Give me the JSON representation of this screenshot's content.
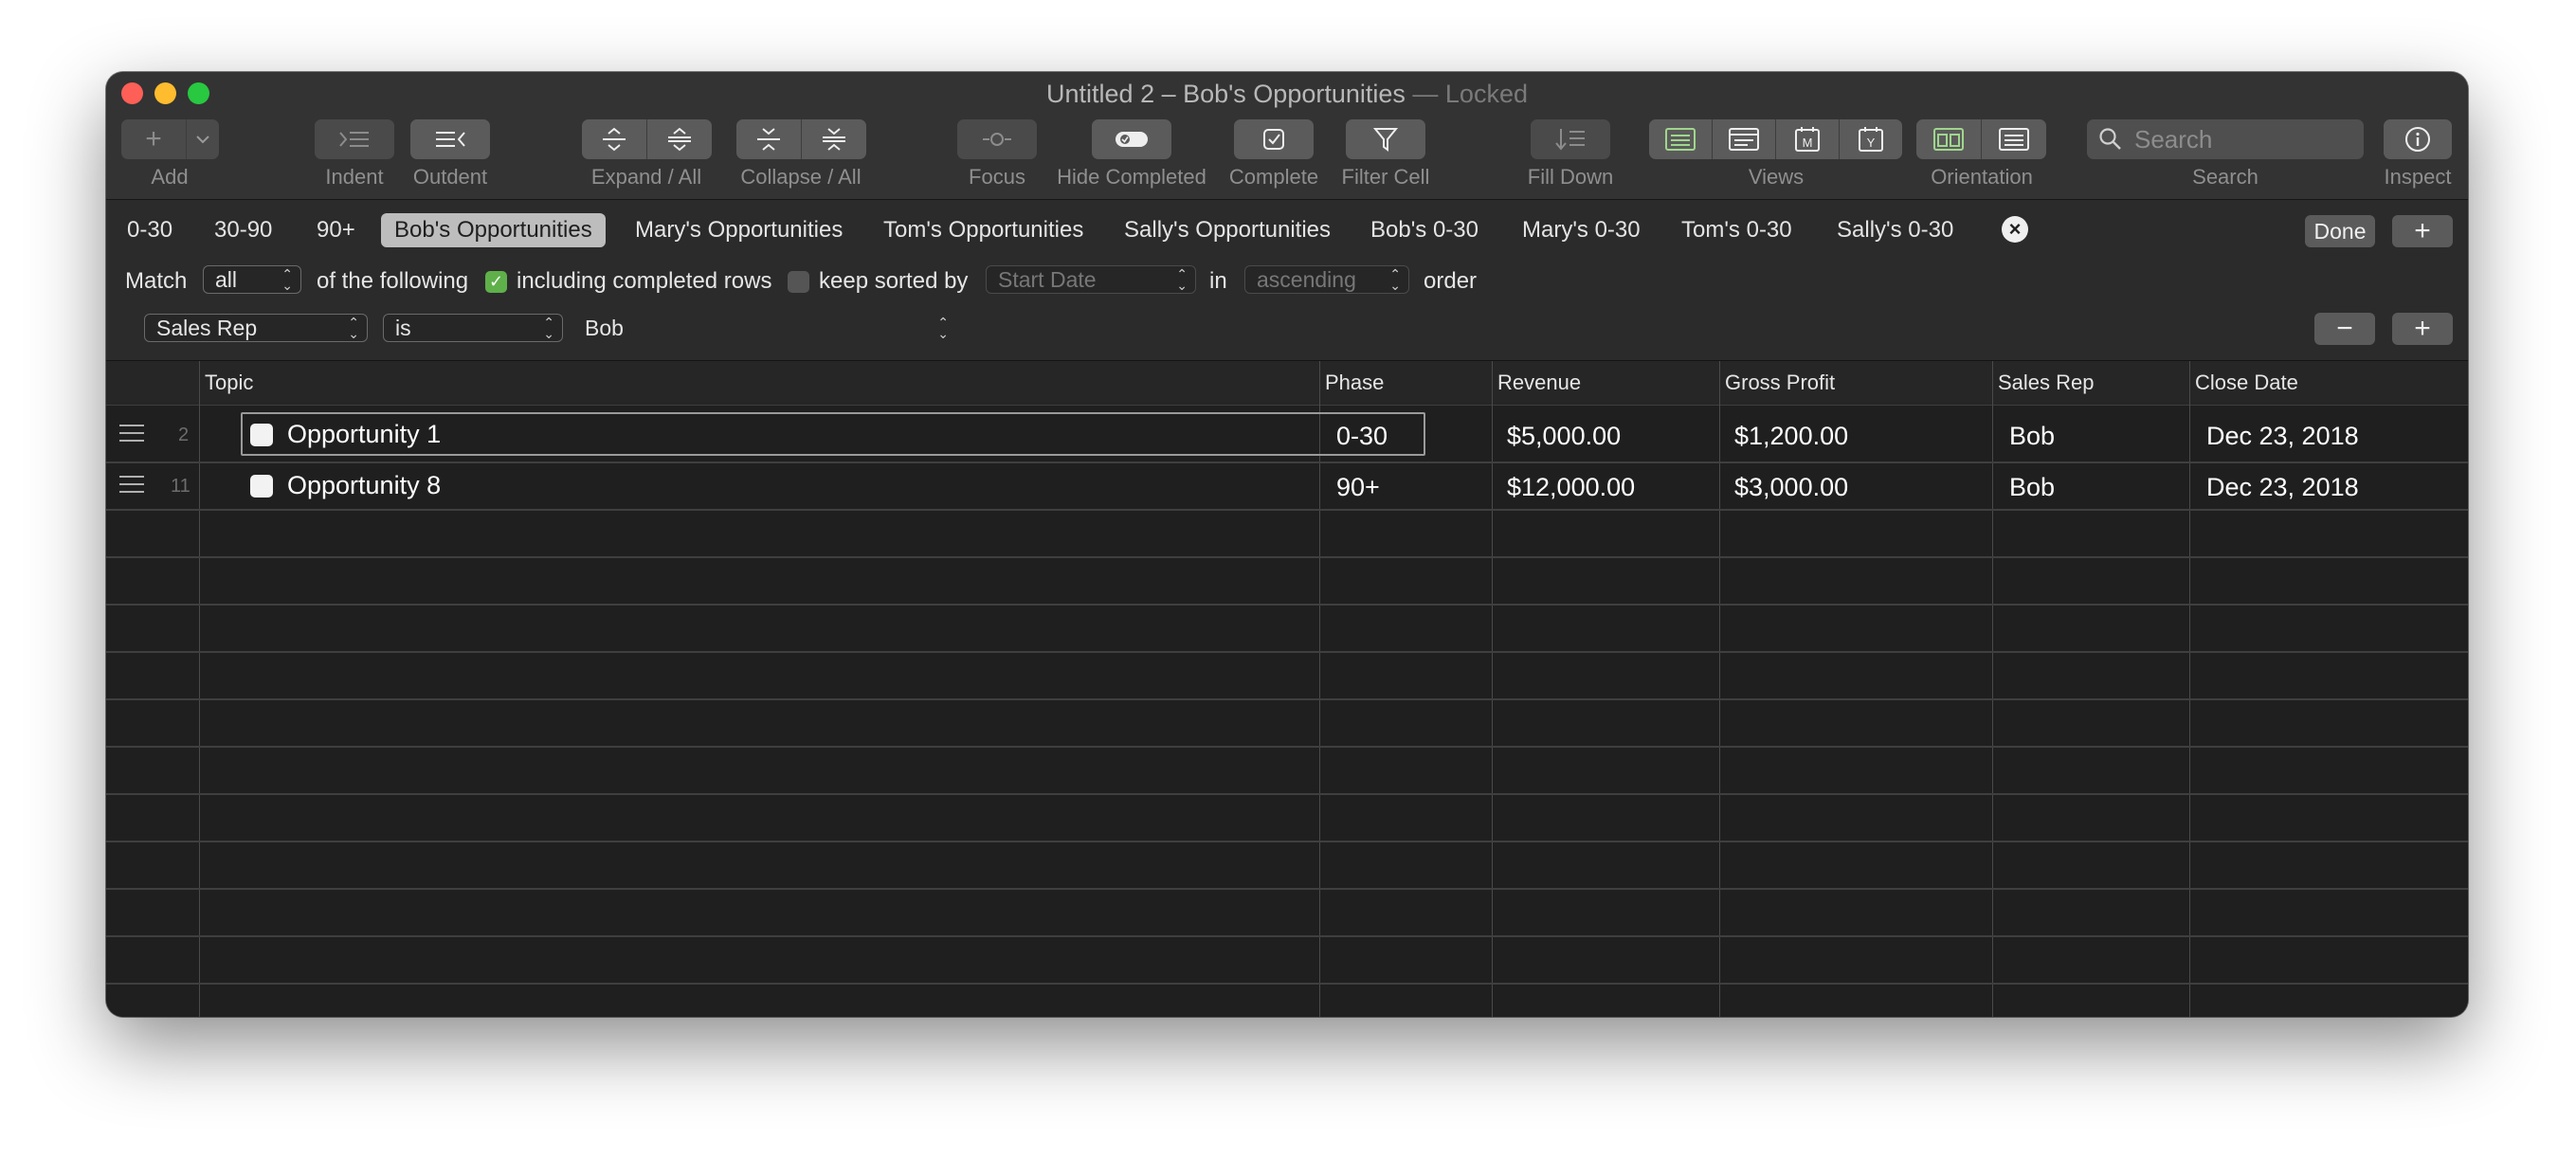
{
  "window": {
    "title": "Untitled 2 – Bob's Opportunities",
    "locked": "— Locked"
  },
  "toolbar": {
    "add": "Add",
    "indent": "Indent",
    "outdent": "Outdent",
    "expand": "Expand / All",
    "collapse": "Collapse / All",
    "focus": "Focus",
    "hide_completed": "Hide Completed",
    "complete": "Complete",
    "filter_cell": "Filter Cell",
    "fill_down": "Fill Down",
    "views": "Views",
    "orientation": "Orientation",
    "search": "Search",
    "search_placeholder": "Search",
    "inspect": "Inspect",
    "accent_color": "#9fd68c"
  },
  "tabs": [
    {
      "label": "0-30"
    },
    {
      "label": "30-90"
    },
    {
      "label": "90+"
    },
    {
      "label": "Bob's Opportunities",
      "active": true
    },
    {
      "label": "Mary's Opportunities"
    },
    {
      "label": "Tom's Opportunities"
    },
    {
      "label": "Sally's Opportunities"
    },
    {
      "label": "Bob's 0-30"
    },
    {
      "label": "Mary's 0-30"
    },
    {
      "label": "Tom's 0-30"
    },
    {
      "label": "Sally's 0-30"
    }
  ],
  "tabbar": {
    "done": "Done"
  },
  "filter": {
    "match": "Match",
    "match_value": "all",
    "of_following": "of the following",
    "including_completed": "including completed rows",
    "including_completed_checked": true,
    "keep_sorted": "keep sorted by",
    "keep_sorted_checked": false,
    "sort_field": "Start Date",
    "in": "in",
    "sort_order": "ascending",
    "order": "order",
    "rule_field": "Sales Rep",
    "rule_op": "is",
    "rule_value": "Bob"
  },
  "table": {
    "columns": [
      "Topic",
      "Phase",
      "Revenue",
      "Gross Profit",
      "Sales Rep",
      "Close Date"
    ],
    "rows": [
      {
        "num": "2",
        "topic": "Opportunity 1",
        "phase": "0-30",
        "revenue": "$5,000.00",
        "gross_profit": "$1,200.00",
        "sales_rep": "Bob",
        "close_date": "Dec 23, 2018"
      },
      {
        "num": "11",
        "topic": "Opportunity 8",
        "phase": "90+",
        "revenue": "$12,000.00",
        "gross_profit": "$3,000.00",
        "sales_rep": "Bob",
        "close_date": "Dec 23, 2018"
      }
    ]
  }
}
